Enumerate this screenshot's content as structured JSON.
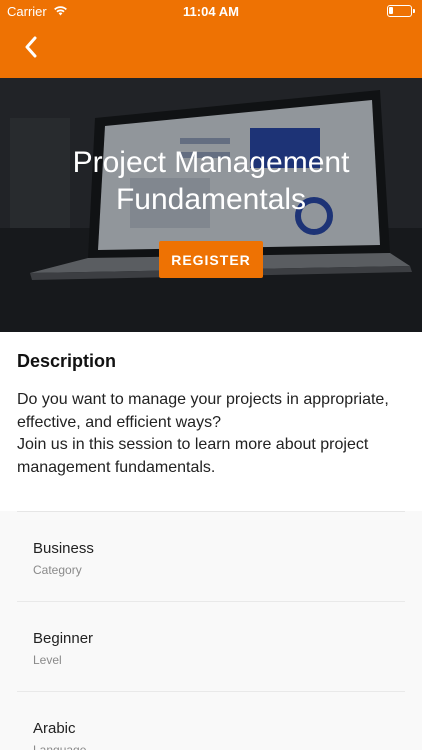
{
  "status_bar": {
    "carrier": "Carrier",
    "time": "11:04 AM"
  },
  "nav": {
    "back_icon": "chevron-left-icon",
    "accent_color": "#EE7203"
  },
  "hero": {
    "title": "Project Management Fundamentals",
    "register_label": "REGISTER"
  },
  "description": {
    "heading": "Description",
    "paragraph_1": "Do you want to manage your projects in appropriate, effective, and efficient ways?",
    "paragraph_2": "Join us in this session to learn more about project management fundamentals."
  },
  "attributes": [
    {
      "value": "Business",
      "label": "Category"
    },
    {
      "value": "Beginner",
      "label": "Level"
    },
    {
      "value": "Arabic",
      "label": "Language"
    }
  ]
}
